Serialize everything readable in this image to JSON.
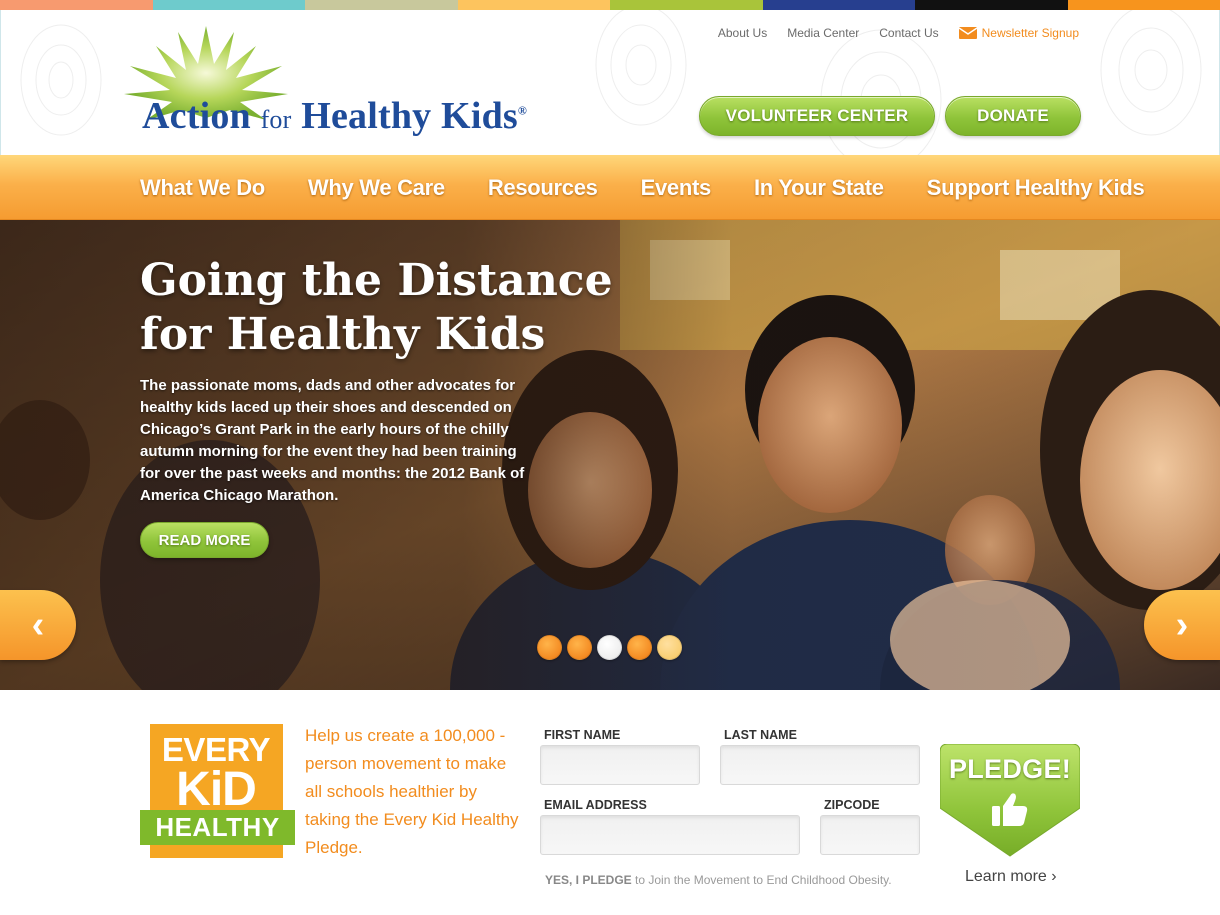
{
  "brand": {
    "name_part1": "Action",
    "name_for": "for",
    "name_part2": "Healthy Kids",
    "registered": "®",
    "accent_green": "#8fc43a",
    "accent_orange": "#f5a623",
    "brand_blue": "#1f4c9a"
  },
  "top_strip_colors": [
    "#f79a6f",
    "#6ecbcc",
    "#c8c89c",
    "#fdc45e",
    "#a9c43a",
    "#273f8f",
    "#111111",
    "#f7941d"
  ],
  "utility_nav": {
    "about": "About Us",
    "media": "Media Center",
    "contact": "Contact Us",
    "newsletter": "Newsletter Signup",
    "newsletter_icon": "mail-icon"
  },
  "header_buttons": {
    "volunteer": "VOLUNTEER CENTER",
    "donate": "DONATE"
  },
  "main_nav": [
    "What We Do",
    "Why We Care",
    "Resources",
    "Events",
    "In Your State",
    "Support Healthy Kids"
  ],
  "hero": {
    "title": "Going the Distance for Healthy Kids",
    "blurb": "The passionate moms, dads and other advocates for healthy kids laced up their shoes and descended on Chicago’s Grant Park in the early hours of the chilly autumn morning for the event they had been training for over the past weeks and months: the 2012 Bank of America Chicago Marathon.",
    "read_more": "READ MORE",
    "prev_icon": "chevron-left-icon",
    "next_icon": "chevron-right-icon",
    "prev_glyph": "‹",
    "next_glyph": "›",
    "slide_count": 5,
    "active_slide": 3
  },
  "pledge": {
    "logo_line1": "EVERY",
    "logo_line2": "KiD",
    "logo_line3": "HEALTHY",
    "copy": "Help us create a 100,000 - person movement to make all schools healthier by taking the Every Kid Healthy Pledge.",
    "first_name_label": "FIRST NAME",
    "last_name_label": "LAST NAME",
    "email_label": "EMAIL ADDRESS",
    "zipcode_label": "ZIPCODE",
    "first_name_value": "",
    "last_name_value": "",
    "email_value": "",
    "zipcode_value": "",
    "note_strong": "YES, I PLEDGE",
    "note_rest": " to Join the Movement to End Childhood Obesity.",
    "button_label": "PLEDGE!",
    "button_icon": "thumbs-up-icon",
    "learn_more": "Learn more ›"
  }
}
